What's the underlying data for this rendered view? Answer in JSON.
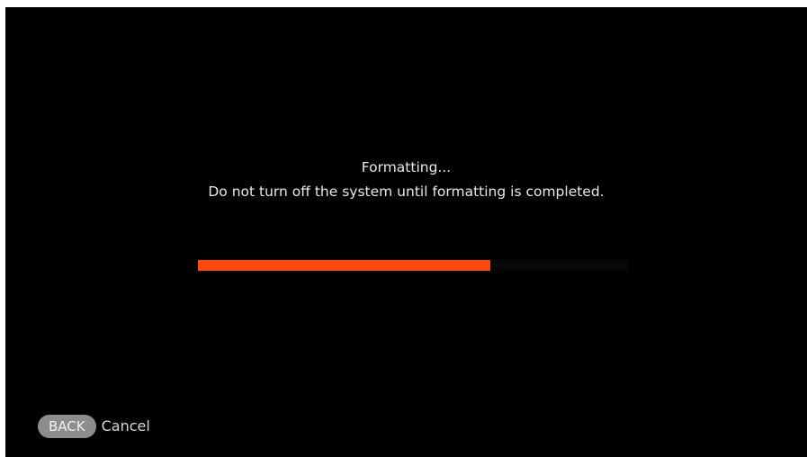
{
  "dialog": {
    "title": "Formatting...",
    "message": "Do not turn off the system until formatting is completed.",
    "progress_fraction": 0.68
  },
  "footer": {
    "back_button_label": "BACK",
    "cancel_label": "Cancel"
  },
  "colors": {
    "background": "#000000",
    "progress_fill": "#ff4a0f",
    "progress_track": "#070707",
    "text": "#e8e8e8",
    "back_button": "#8d8d8d"
  }
}
